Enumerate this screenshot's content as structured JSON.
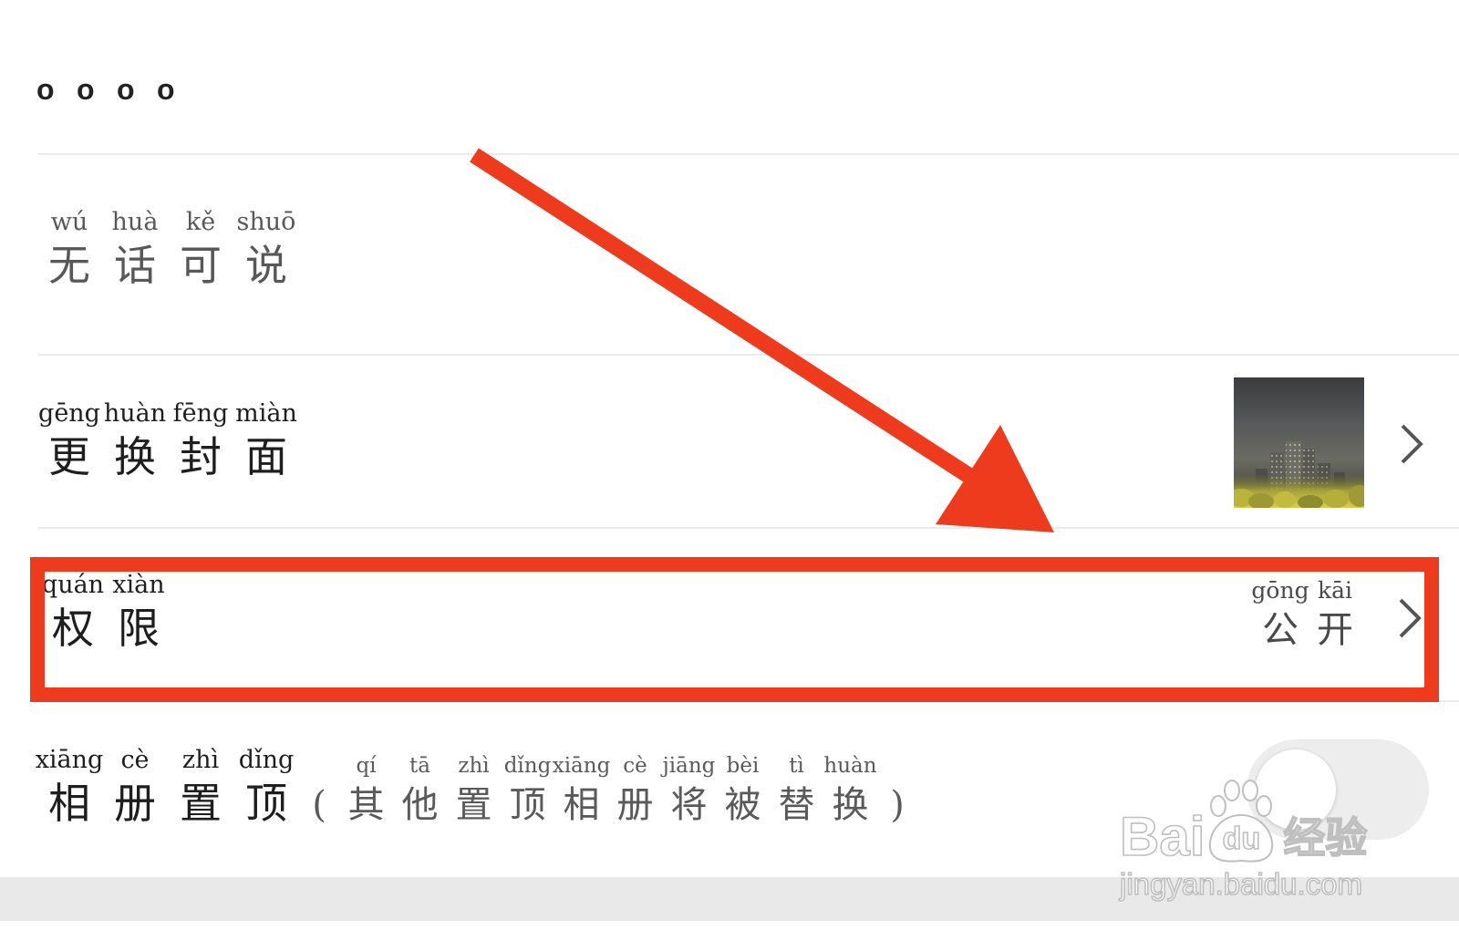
{
  "header": {
    "dots": [
      "o",
      "o",
      "o",
      "o"
    ]
  },
  "rows": [
    {
      "chars": [
        {
          "py": "wú",
          "hz": "无"
        },
        {
          "py": "huà",
          "hz": "话"
        },
        {
          "py": "kě",
          "hz": "可"
        },
        {
          "py": "shuō",
          "hz": "说"
        }
      ]
    },
    {
      "chars": [
        {
          "py": "gēng",
          "hz": "更"
        },
        {
          "py": "huàn",
          "hz": "换"
        },
        {
          "py": "fēng",
          "hz": "封"
        },
        {
          "py": "miàn",
          "hz": "面"
        }
      ],
      "trailing_icon": "chevron-right-icon"
    },
    {
      "chars": [
        {
          "py": "quán",
          "hz": "权"
        },
        {
          "py": "xiàn",
          "hz": "限"
        }
      ],
      "value": [
        {
          "py": "gōng",
          "hz": "公"
        },
        {
          "py": "kāi",
          "hz": "开"
        }
      ],
      "trailing_icon": "chevron-right-icon"
    },
    {
      "chars": [
        {
          "py": "xiāng",
          "hz": "相"
        },
        {
          "py": "cè",
          "hz": "册"
        },
        {
          "py": "zhì",
          "hz": "置"
        },
        {
          "py": "dǐng",
          "hz": "顶"
        }
      ],
      "note": {
        "open": "(",
        "close": ")",
        "chars": [
          {
            "py": "qí",
            "hz": "其"
          },
          {
            "py": "tā",
            "hz": "他"
          },
          {
            "py": "zhì",
            "hz": "置"
          },
          {
            "py": "dǐng",
            "hz": "顶"
          },
          {
            "py": "xiāng",
            "hz": "相"
          },
          {
            "py": "cè",
            "hz": "册"
          },
          {
            "py": "jiāng",
            "hz": "将"
          },
          {
            "py": "bèi",
            "hz": "被"
          },
          {
            "py": "tì",
            "hz": "替"
          },
          {
            "py": "huàn",
            "hz": "换"
          }
        ]
      },
      "toggle": {
        "on": false
      }
    }
  ],
  "annotation": {
    "color": "#ef3b1d"
  },
  "watermark": {
    "brand_latin": "Bai",
    "brand_paw": "du",
    "brand_cn": "经验",
    "url": "jingyan.baidu.com"
  },
  "colors": {
    "background": "#ffffff",
    "divider": "#ebebeb",
    "bottom_band": "#e9e9e9",
    "toggle_track": "#ededed"
  }
}
